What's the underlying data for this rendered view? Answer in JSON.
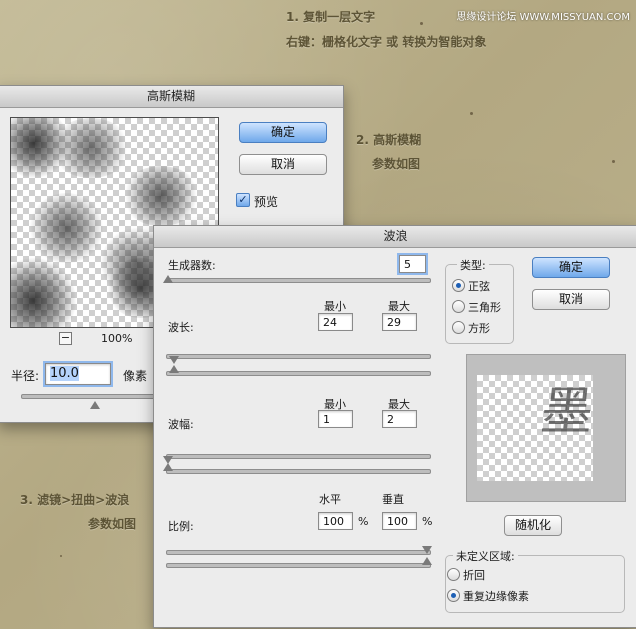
{
  "annotations": {
    "step1_line1": "1. 复制一层文字",
    "step1_line2": "右键：栅格化文字  或  转换为智能对象",
    "step2_line1": "2. 高斯模糊",
    "step2_line2": "参数如图",
    "step3_line1": "3. 滤镜>扭曲>波浪",
    "step3_line2": "参数如图",
    "watermark": "思缘设计论坛 WWW.MISSYUAN.COM"
  },
  "gaussian": {
    "title": "高斯模糊",
    "ok_label": "确定",
    "cancel_label": "取消",
    "preview_label": "预览",
    "preview_checked": true,
    "zoom": "100%",
    "zoom_out_symbol": "−",
    "radius_label": "半径:",
    "radius_value": "10.0",
    "radius_unit": "像素"
  },
  "wave": {
    "title": "波浪",
    "generators_label": "生成器数:",
    "generators_value": "5",
    "min_label": "最小",
    "max_label": "最大",
    "wavelength_label": "波长:",
    "wavelength_min": "24",
    "wavelength_max": "29",
    "amplitude_label": "波幅:",
    "amplitude_min": "1",
    "amplitude_max": "2",
    "scale_label": "比例:",
    "horizontal_label": "水平",
    "vertical_label": "垂直",
    "scale_h": "100",
    "scale_v": "100",
    "percent": "%",
    "type_label": "类型:",
    "type_options": [
      "正弦",
      "三角形",
      "方形"
    ],
    "type_selected": "正弦",
    "ok_label": "确定",
    "cancel_label": "取消",
    "randomize_label": "随机化",
    "undefined_label": "未定义区域:",
    "undefined_options": [
      "折回",
      "重复边缘像素"
    ],
    "undefined_selected": "重复边缘像素",
    "preview_glyph": "墨"
  }
}
